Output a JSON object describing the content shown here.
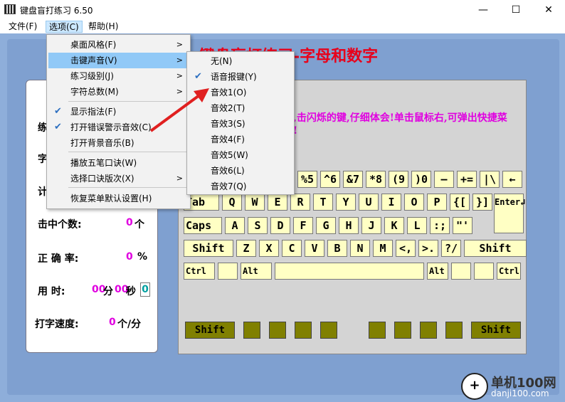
{
  "window": {
    "title": "键盘盲打练习 6.50",
    "minimize": "—",
    "maximize": "☐",
    "close": "✕"
  },
  "menubar": {
    "file": "文件(F)",
    "options": "选项(C)",
    "help": "帮助(H)"
  },
  "heading": "键盘盲打练习-字母和数字",
  "hint": "盘,击闪烁的键,仔细体会!单击鼠标右,可弹出快捷菜单!",
  "stats": {
    "row1_label": "练",
    "row2_label": "字",
    "row3_label": "计",
    "hits_label": "击中个数:",
    "hits_value": "0",
    "hits_unit": "个",
    "accuracy_label": "正 确 率:",
    "accuracy_value": "0",
    "accuracy_unit": "%",
    "time_label": "用    时:",
    "time_min": "00",
    "time_min_unit": "分",
    "time_sec": "00",
    "time_sec_unit": "秒",
    "time_box": "0",
    "speed_label": "打字速度:",
    "speed_value": "0",
    "speed_unit": "个/分"
  },
  "options_menu": {
    "items": [
      {
        "label": "桌面风格(F)",
        "submenu": true,
        "checked": false
      },
      {
        "label": "击键声音(V)",
        "submenu": true,
        "checked": false,
        "highlighted": true
      },
      {
        "label": "练习级别(J)",
        "submenu": true,
        "checked": false
      },
      {
        "label": "字符总数(M)",
        "submenu": true,
        "checked": false
      },
      {
        "label": "显示指法(F)",
        "submenu": false,
        "checked": true
      },
      {
        "label": "打开错误警示音效(C)",
        "submenu": false,
        "checked": true
      },
      {
        "label": "打开背景音乐(B)",
        "submenu": false,
        "checked": false
      },
      {
        "label": "播放五笔口诀(W)",
        "submenu": false,
        "checked": false
      },
      {
        "label": "选择口诀版次(X)",
        "submenu": true,
        "checked": false
      },
      {
        "label": "恢复菜单默认设置(H)",
        "submenu": false,
        "checked": false
      }
    ],
    "arrow": ">",
    "check": "✔"
  },
  "sound_menu": {
    "items": [
      {
        "label": "无(N)",
        "checked": false
      },
      {
        "label": "语音报键(Y)",
        "checked": true
      },
      {
        "label": "音效1(O)",
        "checked": false
      },
      {
        "label": "音效2(T)",
        "checked": false
      },
      {
        "label": "音效3(S)",
        "checked": false
      },
      {
        "label": "音效4(F)",
        "checked": false
      },
      {
        "label": "音效5(W)",
        "checked": false
      },
      {
        "label": "音效6(L)",
        "checked": false
      },
      {
        "label": "音效7(Q)",
        "checked": false
      }
    ]
  },
  "keys": {
    "row_num": [
      "%5",
      "^6",
      "&7",
      "*8",
      "(9",
      ")0",
      "—",
      "+=",
      "|\\",
      "←"
    ],
    "row_tab": [
      "Tab",
      "Q",
      "W",
      "E",
      "R",
      "T",
      "Y",
      "U",
      "I",
      "O",
      "P",
      "{[",
      "}]",
      "Enter↲"
    ],
    "row_caps": [
      "Caps",
      "A",
      "S",
      "D",
      "F",
      "G",
      "H",
      "J",
      "K",
      "L",
      ":;",
      "\"'"
    ],
    "row_shift": [
      "Shift",
      "Z",
      "X",
      "C",
      "V",
      "B",
      "N",
      "M",
      "<,",
      ">.",
      "?/",
      "Shift"
    ],
    "row_ctrl": [
      "Ctrl",
      "",
      "Alt",
      "",
      "Alt",
      "",
      "",
      "Ctrl"
    ],
    "bottom_left": "Shift",
    "bottom_right": "Shift"
  },
  "watermark": {
    "logo": "+",
    "text1": "单机100网",
    "text2": "danji100.com"
  },
  "colors": {
    "heading": "#e8001a",
    "hint": "#e000e0",
    "key_fill": "#ffffc4",
    "bottom_key": "#808000",
    "client_bg": "#8eaeda",
    "menu_highlight": "#91c9f7",
    "arrow": "#e02020"
  }
}
